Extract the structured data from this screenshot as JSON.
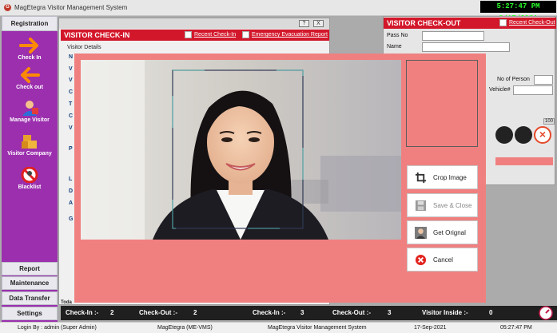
{
  "app": {
    "window_title": "MagEtegra Visitor Management System",
    "icon_letter": "G",
    "clock": "5:27:47 PM 9/17/2021"
  },
  "sidebar": {
    "header": "Registration",
    "items": [
      {
        "label": "Check In",
        "icon": "arrow-right-icon"
      },
      {
        "label": "Check out",
        "icon": "arrow-left-icon"
      },
      {
        "label": "Manage Visitor",
        "icon": "visitor-person-icon"
      },
      {
        "label": "Visitor Company",
        "icon": "boxes-icon"
      },
      {
        "label": "Blacklist",
        "icon": "blocked-icon"
      }
    ],
    "bottom": [
      "Report",
      "Maintenance",
      "Data Transfer",
      "Settings"
    ]
  },
  "checkin_window": {
    "title": "VISITOR CHECK-IN",
    "recent_link": "Recent Check-In",
    "evac_link": "Emergency Evacuation Report",
    "section_label": "Visitor Details",
    "help_btn": "?",
    "close_btn": "X"
  },
  "checkout_window": {
    "title": "VISITOR CHECK-OUT",
    "recent_link": "Recent Check-Out",
    "pass_label": "Pass No",
    "name_label": "Name",
    "persons_label": "No of Person",
    "vehicle_label": "Vehicle#",
    "small_value": "100"
  },
  "photo_dialog": {
    "buttons": [
      {
        "label": "Crop Image",
        "icon": "crop-icon",
        "enabled": true
      },
      {
        "label": "Save & Close",
        "icon": "save-icon",
        "enabled": false
      },
      {
        "label": "Get Orignal",
        "icon": "user-photo-icon",
        "enabled": true
      },
      {
        "label": "Cancel",
        "icon": "cancel-icon",
        "enabled": true
      }
    ]
  },
  "status": {
    "today_label": "Toda",
    "left_checkin_label": "Check-In :-",
    "left_checkin_value": "2",
    "left_checkout_label": "Check-Out :-",
    "left_checkout_value": "2",
    "right_checkin_label": "Check-In :-",
    "right_checkin_value": "3",
    "right_checkout_label": "Check-Out :-",
    "right_checkout_value": "3",
    "inside_label": "Visitor Inside :-",
    "inside_value": "0"
  },
  "footer": {
    "login": "Login By : admin (Super Admin)",
    "product": "MagEtegra (ME-VMS)",
    "system": "MagEtegra Visitor Management System",
    "date": "17-Sep-2021",
    "time": "05:27:47 PM"
  }
}
